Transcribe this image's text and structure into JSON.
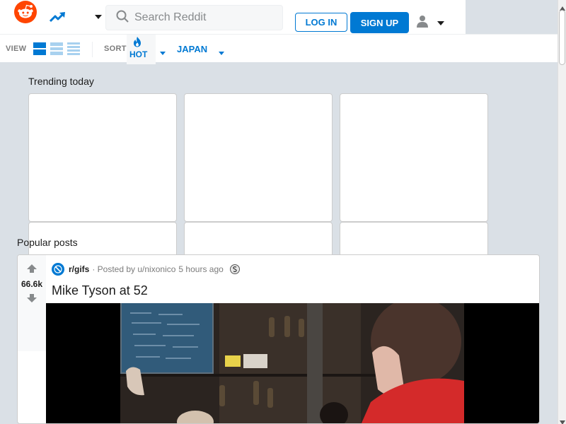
{
  "header": {
    "search_placeholder": "Search Reddit",
    "login_label": "LOG IN",
    "signup_label": "SIGN UP",
    "icons": [
      "reddit-logo-icon",
      "trending-icon",
      "chevron-down-icon",
      "search-icon",
      "user-icon",
      "chevron-down-icon"
    ]
  },
  "sortbar": {
    "view_label": "VIEW",
    "sort_label": "SORT",
    "sort_value": "HOT",
    "region_value": "JAPAN",
    "view_modes": [
      "card",
      "classic",
      "compact"
    ],
    "active_view": "card"
  },
  "trending": {
    "title": "Trending today",
    "card_count": 3
  },
  "popular": {
    "title": "Popular posts",
    "posts": [
      {
        "votes": "66.6k",
        "subreddit": "r/gifs",
        "posted_by": "· Posted by u/nixonico",
        "time": "5 hours ago",
        "title": "Mike Tyson at 52"
      }
    ]
  },
  "colors": {
    "accent": "#0079d3",
    "brand": "#ff4500",
    "background": "#dae0e6"
  }
}
